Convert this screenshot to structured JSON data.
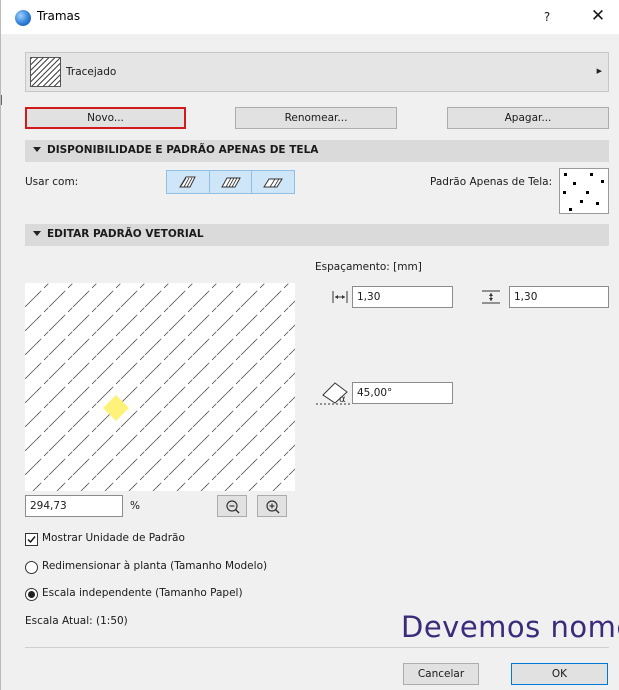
{
  "window": {
    "title": "Tramas",
    "help_label": "?",
    "close_label": "✕"
  },
  "fill_selector": {
    "name": "Tracejado"
  },
  "actions": {
    "new_label": "Novo...",
    "rename_label": "Renomear...",
    "delete_label": "Apagar..."
  },
  "availability": {
    "header": "DISPONIBILIDADE E PADRÃO APENAS DE TELA",
    "use_with_label": "Usar com:",
    "screen_pattern_label": "Padrão Apenas de Tela:"
  },
  "vector": {
    "header": "EDITAR PADRÃO VETORIAL",
    "spacing_label": "Espaçamento: [mm]",
    "horizontal_spacing": "1,30",
    "vertical_spacing": "1,30",
    "angle": "45,00°",
    "angle_symbol": "α",
    "zoom_value": "294,73",
    "zoom_unit": "%"
  },
  "options": {
    "show_pattern_unit": {
      "label": "Mostrar Unidade de Padrão",
      "checked": true
    },
    "scale_radios": [
      {
        "label": "Redimensionar à planta (Tamanho Modelo)",
        "selected": false
      },
      {
        "label": "Escala independente (Tamanho Papel)",
        "selected": true
      }
    ],
    "current_scale": "Escala Atual: (1:50)"
  },
  "overlay_text": "Devemos nome",
  "footer": {
    "cancel_label": "Cancelar",
    "ok_label": "OK"
  },
  "colors": {
    "focus_border": "#d11a1a",
    "segment_bg": "#cfe6f8",
    "handle": "#fff27a",
    "overlay_text": "#3c2b7a"
  }
}
